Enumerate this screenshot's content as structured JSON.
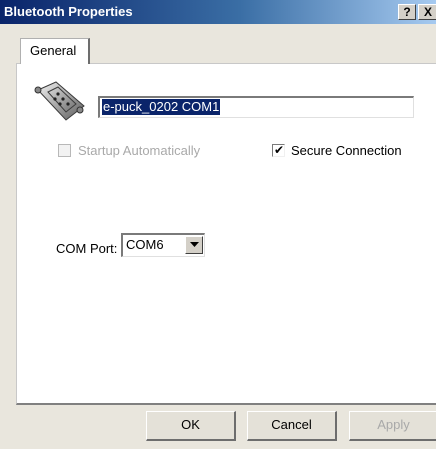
{
  "window": {
    "title": "Bluetooth Properties",
    "help_label": "?",
    "close_label": "X"
  },
  "tabs": [
    {
      "label": "General",
      "selected": true
    }
  ],
  "general": {
    "device_icon": "serial-port-icon",
    "device_name": "e-puck_0202 COM1",
    "startup_automatically": {
      "label": "Startup Automatically",
      "checked": false,
      "enabled": false
    },
    "secure_connection": {
      "label": "Secure Connection",
      "checked": true,
      "enabled": true
    },
    "com_port": {
      "label": "COM Port:",
      "value": "COM6"
    }
  },
  "buttons": {
    "ok": "OK",
    "cancel": "Cancel",
    "apply": "Apply"
  },
  "colors": {
    "title_gradient_start": "#0a246a",
    "title_gradient_end": "#a6caf0",
    "selection": "#0a246a",
    "disabled_text": "#a9a9a9"
  }
}
